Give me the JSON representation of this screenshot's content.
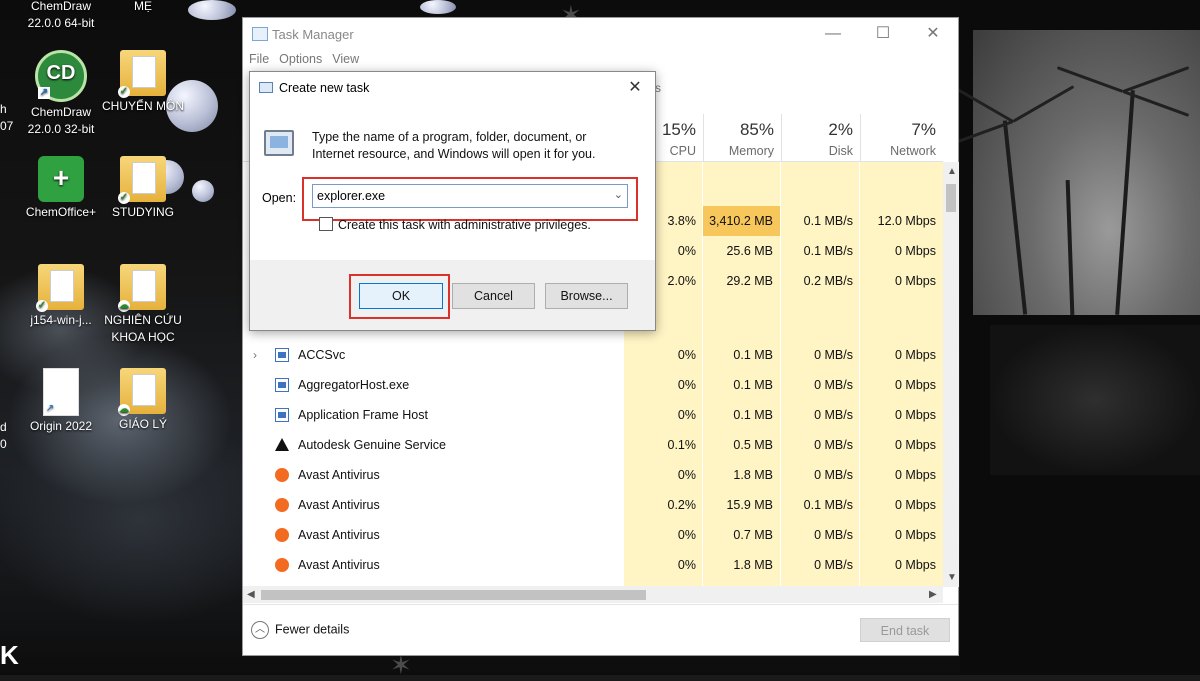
{
  "desktop": {
    "icons": [
      {
        "label": "ChemDraw 22.0.0 64-bit"
      },
      {
        "label": "MẸ"
      },
      {
        "label": "ChemDraw 22.0.0 32-bit"
      },
      {
        "label": "CHUYỂN MÔN"
      },
      {
        "label": "ChemOffice+"
      },
      {
        "label": "STUDYING"
      },
      {
        "label": "j154-win-j..."
      },
      {
        "label": "NGHIÊN CỨU KHOA HỌC"
      },
      {
        "label": "Origin 2022"
      },
      {
        "label": "GIÁO LÝ"
      }
    ],
    "edge_fragments": [
      "h",
      "07",
      "d",
      "0",
      "K"
    ]
  },
  "task_manager": {
    "title": "Task Manager",
    "menu": [
      "File",
      "Options",
      "View"
    ],
    "tab_fragment": "s",
    "columns": [
      {
        "pct": "15%",
        "label": "CPU"
      },
      {
        "pct": "85%",
        "label": "Memory"
      },
      {
        "pct": "2%",
        "label": "Disk"
      },
      {
        "pct": "7%",
        "label": "Network"
      }
    ],
    "top_rows": [
      {
        "cpu": "3.8%",
        "memory": "3,410.2 MB",
        "disk": "0.1 MB/s",
        "network": "12.0 Mbps"
      },
      {
        "cpu": "0%",
        "memory": "25.6 MB",
        "disk": "0.1 MB/s",
        "network": "0 Mbps"
      },
      {
        "cpu": "2.0%",
        "memory": "29.2 MB",
        "disk": "0.2 MB/s",
        "network": "0 Mbps"
      }
    ],
    "rows": [
      {
        "name": "ACCSvc",
        "icon": "service-icon",
        "cpu": "0%",
        "memory": "0.1 MB",
        "disk": "0 MB/s",
        "network": "0 Mbps"
      },
      {
        "name": "AggregatorHost.exe",
        "icon": "service-icon",
        "cpu": "0%",
        "memory": "0.1 MB",
        "disk": "0 MB/s",
        "network": "0 Mbps"
      },
      {
        "name": "Application Frame Host",
        "icon": "service-icon",
        "cpu": "0%",
        "memory": "0.1 MB",
        "disk": "0 MB/s",
        "network": "0 Mbps"
      },
      {
        "name": "Autodesk Genuine Service",
        "icon": "autodesk-icon",
        "cpu": "0.1%",
        "memory": "0.5 MB",
        "disk": "0 MB/s",
        "network": "0 Mbps"
      },
      {
        "name": "Avast Antivirus",
        "icon": "avast-icon",
        "cpu": "0%",
        "memory": "1.8 MB",
        "disk": "0 MB/s",
        "network": "0 Mbps"
      },
      {
        "name": "Avast Antivirus",
        "icon": "avast-icon",
        "cpu": "0.2%",
        "memory": "15.9 MB",
        "disk": "0.1 MB/s",
        "network": "0 Mbps"
      },
      {
        "name": "Avast Antivirus",
        "icon": "avast-icon",
        "cpu": "0%",
        "memory": "0.7 MB",
        "disk": "0 MB/s",
        "network": "0 Mbps"
      },
      {
        "name": "Avast Antivirus",
        "icon": "avast-icon",
        "cpu": "0%",
        "memory": "1.8 MB",
        "disk": "0 MB/s",
        "network": "0 Mbps"
      }
    ],
    "fewer_details": "Fewer details",
    "end_task": "End task"
  },
  "dialog": {
    "title": "Create new task",
    "description": "Type the name of a program, folder, document, or Internet resource, and Windows will open it for you.",
    "open_label": "Open:",
    "open_value": "explorer.exe",
    "admin_label": "Create this task with administrative privileges.",
    "ok": "OK",
    "cancel": "Cancel",
    "browse": "Browse...",
    "highlight_color": "#d9322b"
  }
}
